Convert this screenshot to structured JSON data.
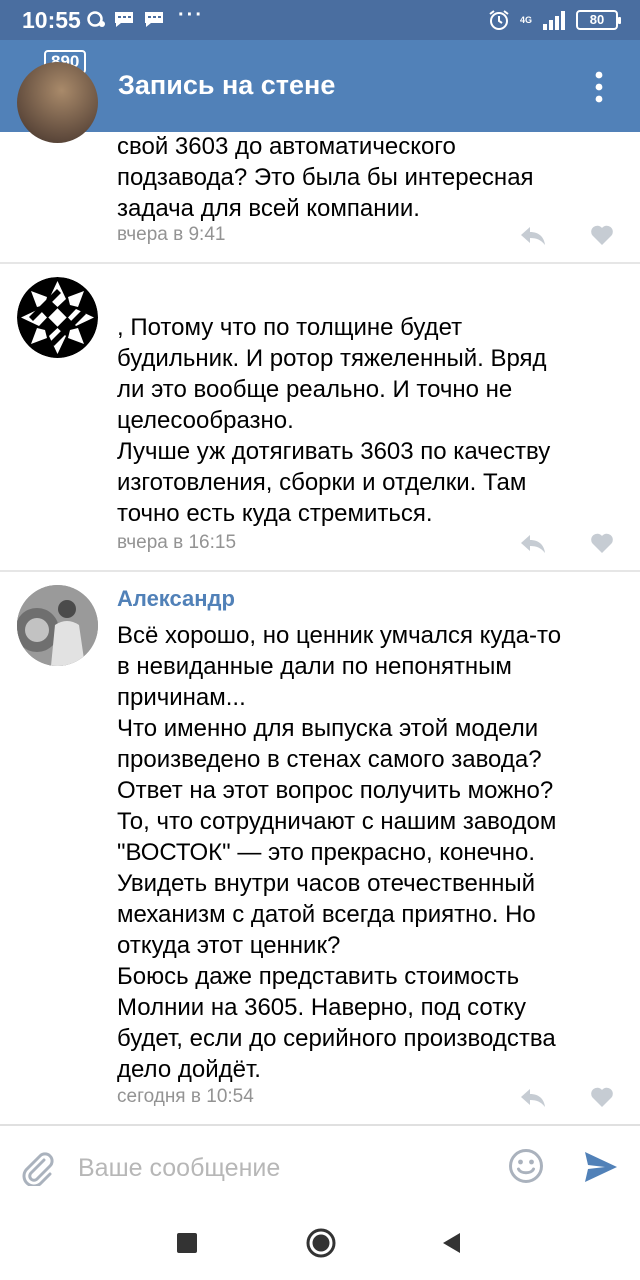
{
  "status_bar": {
    "time": "10:55",
    "network": "4G",
    "battery": "80",
    "more_indicator": "···"
  },
  "app_bar": {
    "title": "Запись на стене",
    "back_badge": "890",
    "icons": [
      "back-arrow-icon",
      "more-vert-icon"
    ]
  },
  "comments": [
    {
      "author": "",
      "text": "свой 3603 до автоматического\nподзавода? Это была бы интересная\nзадача для всей компании.",
      "time": "вчера в 9:41"
    },
    {
      "author": "",
      "text": "          , Потому что по толщине будет\nбудильник. И ротор тяжеленный. Вряд\nли это вообще реально. И точно не\nцелесообразно.\nЛучше уж дотягивать 3603 по качеству\nизготовления, сборки и отделки. Там\nточно есть куда стремиться.",
      "time": "вчера в 16:15"
    },
    {
      "author": "Александр",
      "text": "Всё хорошо, но ценник умчался куда-то\nв невиданные дали по непонятным\nпричинам...\nЧто именно для выпуска этой модели\nпроизведено в стенах самого завода?\nОтвет на этот вопрос получить можно?\nТо, что сотрудничают с нашим заводом\n\"ВОСТОК\" — это прекрасно, конечно.\nУвидеть внутри часов отечественный\nмеханизм с датой всегда приятно. Но\nоткуда этот ценник?\nБоюсь даже представить стоимость\nМолнии на 3605. Наверно, под сотку\nбудет, если до серийного производства\nдело дойдёт.",
      "time": "сегодня в 10:54"
    }
  ],
  "composer": {
    "placeholder": "Ваше сообщение",
    "value": ""
  },
  "colors": {
    "status_bar": "#4a6ea0",
    "app_bar": "#5181b8",
    "author_link": "#5181b8",
    "timestamp": "#939393",
    "send_icon": "#5181b8"
  }
}
